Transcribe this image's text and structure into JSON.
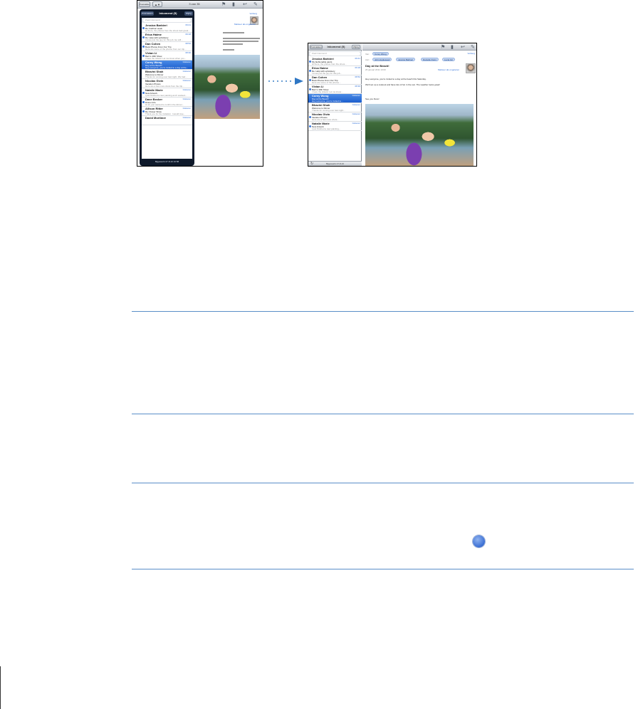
{
  "portrait": {
    "toolbar": {
      "mailbox_button": "Postvakken",
      "page_counter": "3 van 35"
    },
    "popover": {
      "left_button": "Postvakken",
      "title": "Inkomend (5)",
      "right_button": "Wijzig",
      "search_placeholder": "Zoek Inkomend",
      "footer": "Bijgewerkt 27-8-10 10:58"
    },
    "messages": [
      {
        "from": "Jessica Barbieri",
        "date": "09:41",
        "subject": "Re: Fashion week",
        "preview": "Hi there, the photos from the shoot look great...",
        "unread": true
      },
      {
        "from": "Erica Haime",
        "date": "09:18",
        "subject": "Re: Help with upholstery",
        "preview": "I know just the guy for this job. He will...",
        "unread": true
      },
      {
        "from": "Dan Cohen",
        "date": "08:52",
        "subject": "Book Photos From Our Trip",
        "preview": "Here are some of the photos from our trip...",
        "unread": true
      },
      {
        "from": "Vivian Li",
        "date": "08:30",
        "subject": "Barn's 40th Show",
        "preview": "I have the tickets! Let me know when you...",
        "unread": true
      },
      {
        "from": "Corey Wong",
        "date": "Gisteren",
        "subject": "Day at the Beach!",
        "preview": "Hey everyone, you're invited to a day at the...",
        "unread": false,
        "selected": true
      },
      {
        "from": "Bhavini Shah",
        "date": "Gisteren",
        "subject": "Welcome to Dinner",
        "preview": "Thanks for coming over last night. We had...",
        "unread": false
      },
      {
        "from": "Nicolas Givin",
        "date": "Gisteren",
        "subject": "Vacation Photos",
        "preview": "Here are a few more shots from the trip...",
        "unread": false
      },
      {
        "from": "Natalie Marie",
        "date": "Gisteren",
        "subject": "New Artwork",
        "preview": "I just finished a new painting and I wanted...",
        "unread": true
      },
      {
        "from": "Dave Becker",
        "date": "Gisteren",
        "subject": "Dinner Info",
        "preview": "Hi all, just wanted to confirm the dinner...",
        "unread": true
      },
      {
        "from": "Allison Ritter",
        "date": "Gisteren",
        "subject": "Re: Flower Show",
        "preview": "Thank you for the invitation. I would love...",
        "unread": true
      },
      {
        "from": "David Mortimer",
        "date": "Gisteren",
        "subject": "",
        "preview": "",
        "unread": false
      }
    ],
    "message": {
      "reply_link": "Verberg",
      "more_link": "Markeer als ongelezen"
    }
  },
  "landscape": {
    "sidebar": {
      "left_button": "Postvakken",
      "title": "Inkomend (5)",
      "right_button": "Wijzig",
      "search_placeholder": "Zoek Inkomend",
      "footer": "Bijgewerkt 27-8-10"
    },
    "messages": [
      {
        "from": "Jessica Barbieri",
        "date": "09:41",
        "subject": "My fashionable pants",
        "preview": "Hi there, the photos from the shoot...",
        "unread": true
      },
      {
        "from": "Erica Haime",
        "date": "09:18",
        "subject": "Re: Help with upholstery",
        "preview": "I know just the guy for this job...",
        "unread": true
      },
      {
        "from": "Dan Cohen",
        "date": "08:52",
        "subject": "Book Photos From Our Trip",
        "preview": "Here are some of the photos...",
        "unread": true
      },
      {
        "from": "Vivian Li",
        "date": "08:30",
        "subject": "Barn's 40th Show",
        "preview": "I have the tickets! Let me know...",
        "unread": true
      },
      {
        "from": "Corey Wong",
        "date": "Gisteren",
        "subject": "Day at the Beach!",
        "preview": "Hey everyone, you're invited to...",
        "unread": false,
        "selected": true
      },
      {
        "from": "Bhavini Shah",
        "date": "Gisteren",
        "subject": "Welcome to Dinner",
        "preview": "Thanks for coming over last night...",
        "unread": false
      },
      {
        "from": "Nicolas Givin",
        "date": "Gisteren",
        "subject": "Vacation Photos",
        "preview": "Here are a few more shots...",
        "unread": true
      },
      {
        "from": "Natalie Marie",
        "date": "Gisteren",
        "subject": "New Artwork",
        "preview": "I just finished a new painting...",
        "unread": true
      }
    ],
    "message": {
      "from_label": "Van:",
      "from_chip": "Corey Wong",
      "to_label": "Aan:",
      "to_chips": [
        "John Appleseed",
        "Jessica Barbieri",
        "Danielle Dunn",
        "Lucia Gil"
      ],
      "hide_link": "Verberg",
      "subject": "Day at the Beach!",
      "date": "26 januari 2011 10:00",
      "mark_link": "Markeer als ongelezen",
      "body_line1": "Hey everyone, you're invited to a day at the beach this Saturday.",
      "body_line2": "We'll set up a cookout and have lots of fun in the sun. The weather looks great!",
      "sign_off": "See you there!"
    }
  },
  "colors": {
    "rule": "#5a8ec8",
    "selection": "#1d5fce",
    "unread_dot": "#3c7be0"
  }
}
